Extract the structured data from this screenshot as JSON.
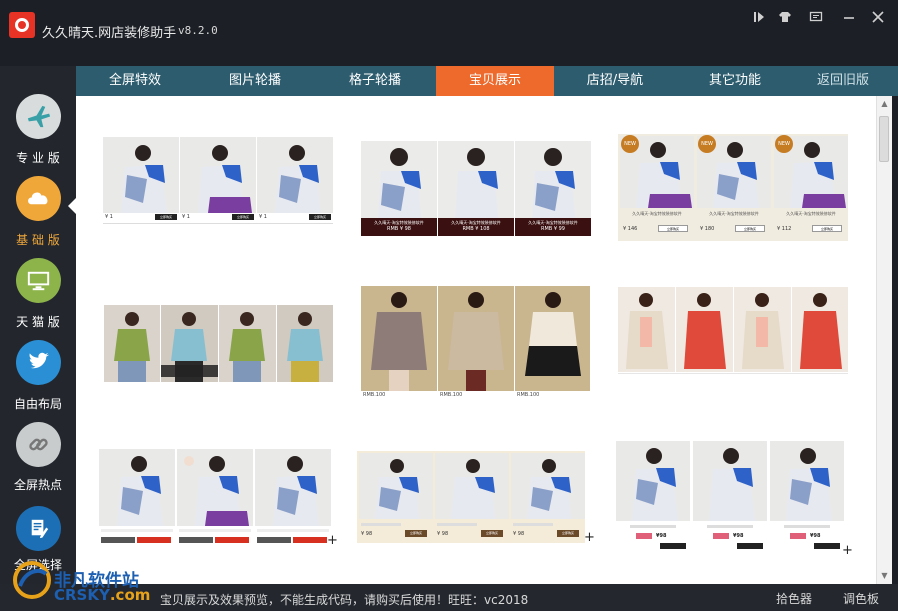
{
  "app": {
    "title": "久久晴天.网店装修助手",
    "version": "v8.2.0",
    "icon": "app-logo-icon"
  },
  "window_controls": [
    {
      "name": "play-icon",
      "glyph": "⏵"
    },
    {
      "name": "skin-shirt-icon",
      "glyph": "👕"
    },
    {
      "name": "message-icon",
      "glyph": "▭"
    },
    {
      "name": "minimize-icon",
      "glyph": "—"
    },
    {
      "name": "close-icon",
      "glyph": "✕"
    }
  ],
  "sidebar": {
    "items": [
      {
        "label": "专 业 版",
        "icon": "airplane-icon",
        "color": "#d8dcdc"
      },
      {
        "label": "基 础 版",
        "icon": "cloud-icon",
        "color": "#f0a73a",
        "active": true
      },
      {
        "label": "天 猫 版",
        "icon": "monitor-icon",
        "color": "#8db34b"
      },
      {
        "label": "自由布局",
        "icon": "twitter-bird-icon",
        "color": "#2a8fd4"
      },
      {
        "label": "全屏热点",
        "icon": "link-icon",
        "color": "#c8cccc"
      },
      {
        "label": "全屏选择",
        "icon": "edit-document-icon",
        "color": "#1d6fb5"
      }
    ]
  },
  "tabs": [
    {
      "label": "全屏特效"
    },
    {
      "label": "图片轮播"
    },
    {
      "label": "格子轮播"
    },
    {
      "label": "宝贝展示",
      "active": true
    },
    {
      "label": "店招/导航"
    },
    {
      "label": "其它功能"
    },
    {
      "label": "返回旧版"
    }
  ],
  "templates": {
    "t1": {
      "prices": [
        "¥ 1",
        "¥ 1",
        "¥ 1"
      ],
      "buy": "立即购买"
    },
    "t2": {
      "caption": "久久晴天-淘宝特效装修软件",
      "prices": [
        "RMB ¥ 98",
        "RMB ¥ 108",
        "RMB ¥ 99"
      ]
    },
    "t3": {
      "badge": "NEW",
      "caption": "久久晴天-淘宝特效装修软件",
      "prices": [
        "¥ 146",
        "¥ 180",
        "¥ 112"
      ],
      "buy": "立即购买"
    },
    "t5": {
      "prices": [
        "RMB.100",
        "RMB.100",
        "RMB.100"
      ]
    },
    "t8": {
      "prices": [
        "¥ 98",
        "¥ 98",
        "¥ 98"
      ],
      "buy": "立即购买"
    },
    "t9": {
      "prices": [
        "¥98",
        "¥98",
        "¥98"
      ]
    },
    "plus": "+"
  },
  "status": {
    "text": "宝贝展示及效果预览，不能生成代码，请购买后使用！旺旺：vc2018",
    "picker": "拾色器",
    "palette": "调色板"
  },
  "watermark": {
    "line1": "非凡软件站",
    "line2a": "CRSKY",
    "line2b": ".com"
  },
  "colors": {
    "accent": "#ee6a2c",
    "tabbar": "#2d5c6e",
    "active_label": "#f0a73a"
  }
}
